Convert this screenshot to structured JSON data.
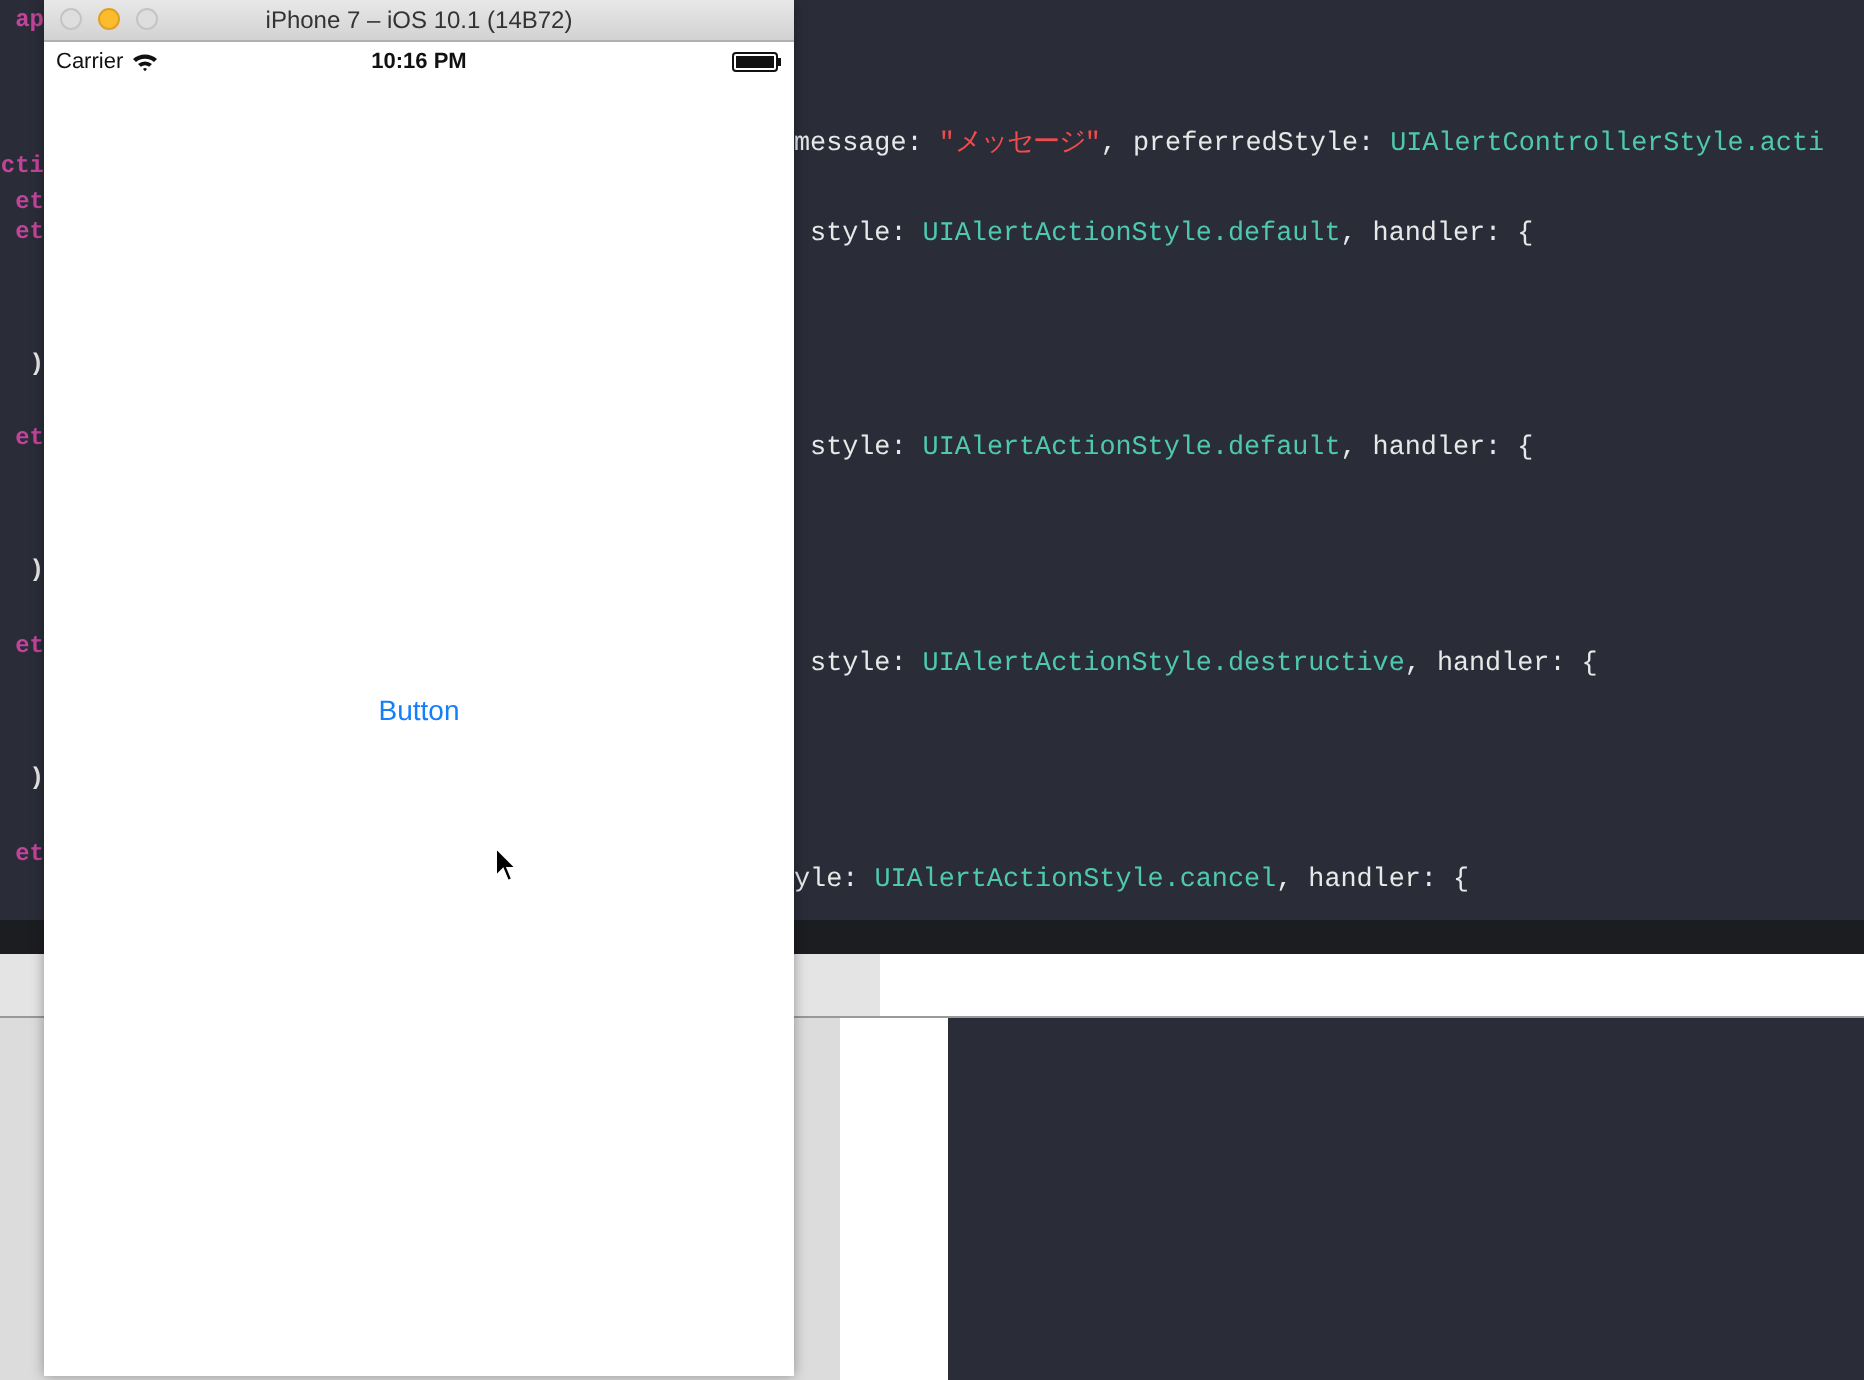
{
  "editor": {
    "gutter_fragments": [
      {
        "text": "ap",
        "kind": "keyword"
      },
      {
        "text": "cti",
        "kind": "keyword"
      },
      {
        "text": "et",
        "kind": "keyword"
      },
      {
        "text": "et",
        "kind": "keyword"
      },
      {
        "text": ")",
        "kind": "plain"
      },
      {
        "text": "et",
        "kind": "keyword"
      },
      {
        "text": ")",
        "kind": "plain"
      },
      {
        "text": "et",
        "kind": "keyword"
      },
      {
        "text": ")",
        "kind": "plain"
      },
      {
        "text": "et",
        "kind": "keyword"
      }
    ],
    "code_lines": [
      [
        {
          "text": "message: ",
          "kind": "plain"
        },
        {
          "text": "\"メッセージ\"",
          "kind": "string"
        },
        {
          "text": ", preferredStyle: ",
          "kind": "plain"
        },
        {
          "text": "UIAlertControllerStyle.acti",
          "kind": "type"
        }
      ],
      [
        {
          "text": " style: ",
          "kind": "plain"
        },
        {
          "text": "UIAlertActionStyle.default",
          "kind": "type"
        },
        {
          "text": ", handler: {",
          "kind": "plain"
        }
      ],
      [
        {
          "text": " style: ",
          "kind": "plain"
        },
        {
          "text": "UIAlertActionStyle.default",
          "kind": "type"
        },
        {
          "text": ", handler: {",
          "kind": "plain"
        }
      ],
      [
        {
          "text": " style: ",
          "kind": "plain"
        },
        {
          "text": "UIAlertActionStyle.destructive",
          "kind": "type"
        },
        {
          "text": ", handler: {",
          "kind": "plain"
        }
      ],
      [
        {
          "text": "yle: ",
          "kind": "plain"
        },
        {
          "text": "UIAlertActionStyle.cancel",
          "kind": "type"
        },
        {
          "text": ", handler: {",
          "kind": "plain"
        }
      ]
    ]
  },
  "simulator": {
    "title": "iPhone 7 – iOS 10.1 (14B72)",
    "status_bar": {
      "carrier": "Carrier",
      "time": "10:16 PM"
    },
    "button": "Button"
  }
}
